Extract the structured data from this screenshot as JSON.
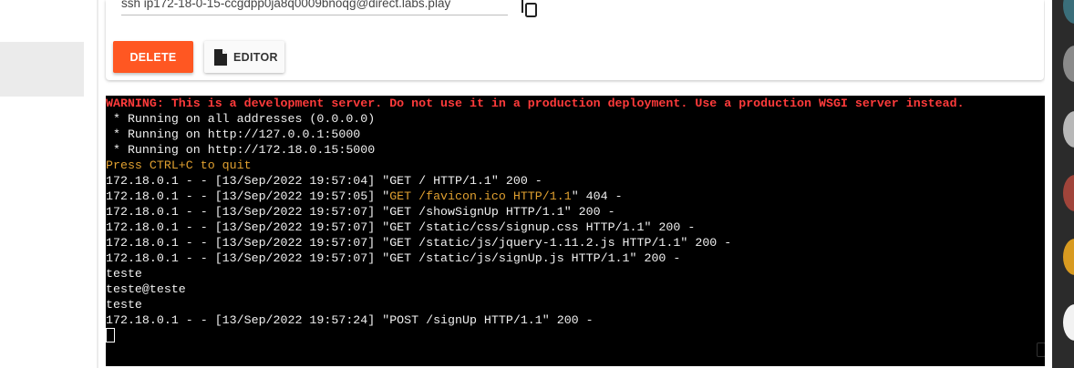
{
  "card": {
    "ssh_command": "ssh ip172-18-0-15-ccgdpp0ja8q0009bnoqg@direct.labs.play",
    "delete_label": "DELETE",
    "editor_label": "EDITOR"
  },
  "terminal": {
    "warning": "WARNING: This is a development server. Do not use it in a production deployment. Use a production WSGI server instead.",
    "running_1": " * Running on all addresses (0.0.0.0)",
    "running_2": " * Running on http://127.0.0.1:5000",
    "running_3": " * Running on http://172.18.0.15:5000",
    "press_quit": "Press CTRL+C to quit",
    "log_1": "172.18.0.1 - - [13/Sep/2022 19:57:04] \"GET / HTTP/1.1\" 200 -",
    "log_2_prefix": "172.18.0.1 - - [13/Sep/2022 19:57:05] \"",
    "log_2_request": "GET /favicon.ico HTTP/1.1",
    "log_2_suffix": "\" 404 -",
    "log_3": "172.18.0.1 - - [13/Sep/2022 19:57:07] \"GET /showSignUp HTTP/1.1\" 200 -",
    "log_4": "172.18.0.1 - - [13/Sep/2022 19:57:07] \"GET /static/css/signup.css HTTP/1.1\" 200 -",
    "log_5": "172.18.0.1 - - [13/Sep/2022 19:57:07] \"GET /static/js/jquery-1.11.2.js HTTP/1.1\" 200 -",
    "log_6": "172.18.0.1 - - [13/Sep/2022 19:57:07] \"GET /static/js/signUp.js HTTP/1.1\" 200 -",
    "out_1": "teste",
    "out_2": "teste@teste",
    "out_3": "teste",
    "log_7": "172.18.0.1 - - [13/Sep/2022 19:57:24] \"POST /signUp HTTP/1.1\" 200 -"
  },
  "colors": {
    "delete_button": "#ff5722",
    "warning_text": "#ff3b3b",
    "highlight_text": "#e0a030",
    "terminal_bg": "#000000"
  },
  "icons": {
    "copy": "copy-icon",
    "editor": "file-icon"
  }
}
